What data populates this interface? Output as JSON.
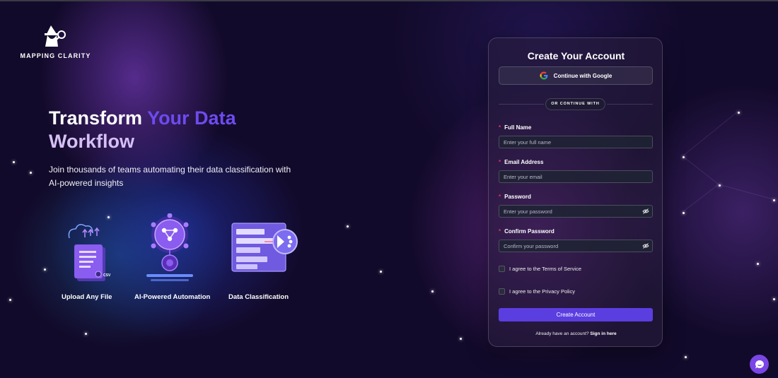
{
  "brand": {
    "name": "MAPPING CLARITY",
    "logo_icon": "wizard-magnifier-icon"
  },
  "hero": {
    "title_part1": "Transform ",
    "title_part2": "Your Data",
    "title_part3": "Workflow",
    "subtitle": "Join thousands of teams automating their data classification with AI-powered insights",
    "features": [
      {
        "label": "Upload Any File",
        "icon": "file-upload-icon"
      },
      {
        "label": "AI-Powered Automation",
        "icon": "ai-network-icon"
      },
      {
        "label": "Data Classification",
        "icon": "data-classification-icon"
      }
    ]
  },
  "form": {
    "title": "Create Your Account",
    "google_label": "Continue with Google",
    "divider": "or continue with",
    "fields": {
      "full_name": {
        "label": "Full Name",
        "placeholder": "Enter your full name"
      },
      "email": {
        "label": "Email Address",
        "placeholder": "Enter your email"
      },
      "password": {
        "label": "Password",
        "placeholder": "Enter your password"
      },
      "confirm": {
        "label": "Confirm Password",
        "placeholder": "Confirm your password"
      }
    },
    "terms_label": "I agree to the Terms of Service",
    "privacy_label": "I agree to the Privacy Policy",
    "submit_label": "Create Account",
    "signin_prompt": "Already have an account?",
    "signin_link": "Sign in here"
  },
  "colors": {
    "accent": "#5b3ee0",
    "title_highlight": "#6d4bf0",
    "required": "#e0345a",
    "background": "#120a2a"
  }
}
